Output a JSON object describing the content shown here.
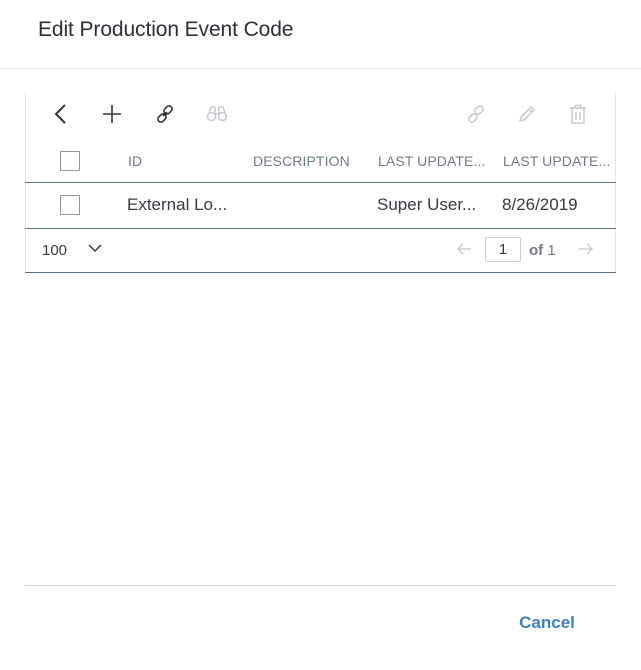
{
  "dialog": {
    "title": "Edit Production Event Code"
  },
  "toolbar": {
    "buttons": [
      {
        "name": "back",
        "icon": "chevron-left-icon",
        "enabled": true
      },
      {
        "name": "add",
        "icon": "plus-icon",
        "enabled": true
      },
      {
        "name": "link",
        "icon": "link-icon",
        "enabled": true
      },
      {
        "name": "find",
        "icon": "binoculars-icon",
        "enabled": false
      },
      {
        "name": "unlink",
        "icon": "unlink-icon",
        "enabled": false
      },
      {
        "name": "edit",
        "icon": "pencil-icon",
        "enabled": false
      },
      {
        "name": "delete",
        "icon": "trash-icon",
        "enabled": false
      }
    ]
  },
  "table": {
    "columns": [
      "ID",
      "DESCRIPTION",
      "LAST UPDATE...",
      "LAST UPDATE..."
    ],
    "rows": [
      {
        "id": "External Lo...",
        "description": "",
        "last_updated_by": "Super User...",
        "last_updated": "8/26/2019",
        "checked": false
      }
    ]
  },
  "pager": {
    "page_size": "100",
    "current_page": "1",
    "of_label": "of",
    "total_pages": "1"
  },
  "footer": {
    "cancel_label": "Cancel"
  },
  "colors": {
    "accent": "#3f7fcf",
    "divider": "#5b6f80",
    "disabled_icon": "#c6ccd2"
  }
}
